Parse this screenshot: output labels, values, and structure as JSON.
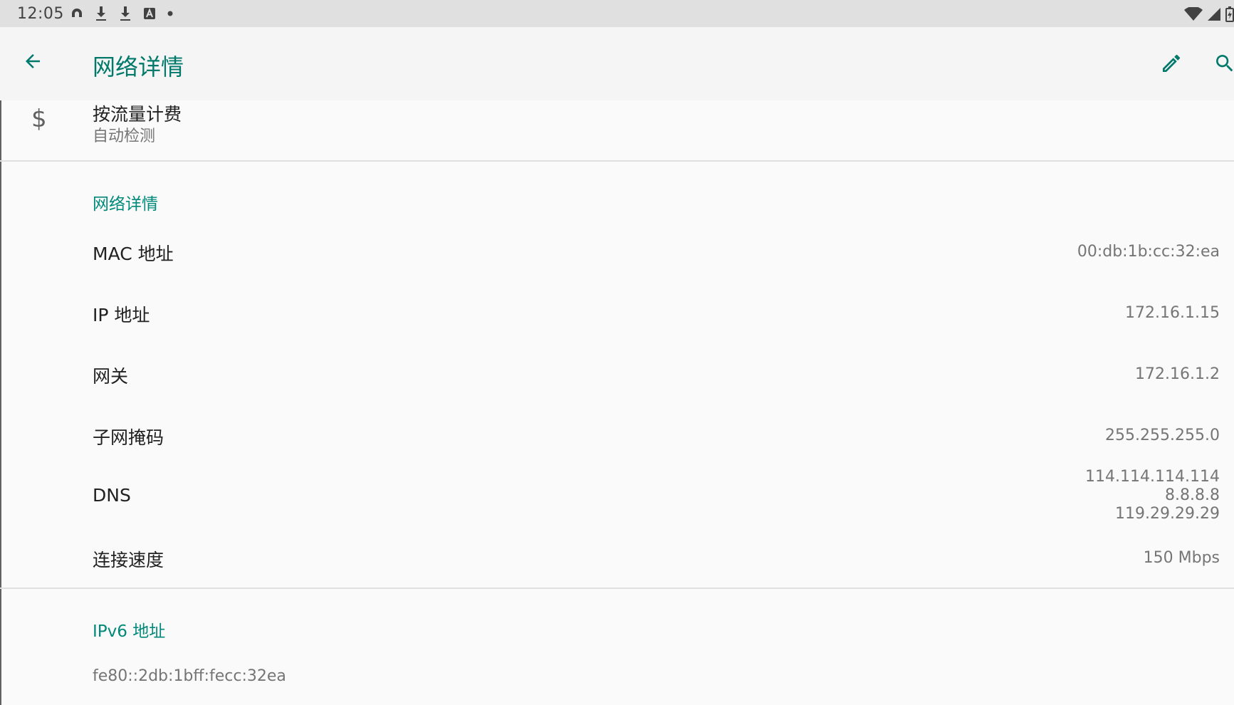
{
  "status_bar": {
    "time": "12:05",
    "left_icons": [
      "headphones-icon",
      "download-icon",
      "download-icon",
      "accessibility-a-icon",
      "dot-icon"
    ],
    "right_icons": [
      "wifi-icon",
      "cellular-signal-icon",
      "battery-icon"
    ]
  },
  "app_bar": {
    "title": "网络详情",
    "back_icon": "arrow-back-icon",
    "edit_icon": "pencil-icon",
    "search_icon": "search-icon",
    "accent_color": "#00796b"
  },
  "metered": {
    "icon": "dollar-icon",
    "icon_glyph": "$",
    "title": "按流量计费",
    "summary": "自动检测"
  },
  "network_details": {
    "header": "网络详情",
    "mac": {
      "label": "MAC 地址",
      "value": "00:db:1b:cc:32:ea"
    },
    "ip": {
      "label": "IP 地址",
      "value": "172.16.1.15"
    },
    "gateway": {
      "label": "网关",
      "value": "172.16.1.2"
    },
    "subnet": {
      "label": "子网掩码",
      "value": "255.255.255.0"
    },
    "dns": {
      "label": "DNS",
      "values": [
        "114.114.114.114",
        "8.8.8.8",
        "119.29.29.29"
      ]
    },
    "speed": {
      "label": "连接速度",
      "value": "150 Mbps"
    }
  },
  "ipv6": {
    "header": "IPv6 地址",
    "value": "fe80::2db:1bff:fecc:32ea"
  }
}
